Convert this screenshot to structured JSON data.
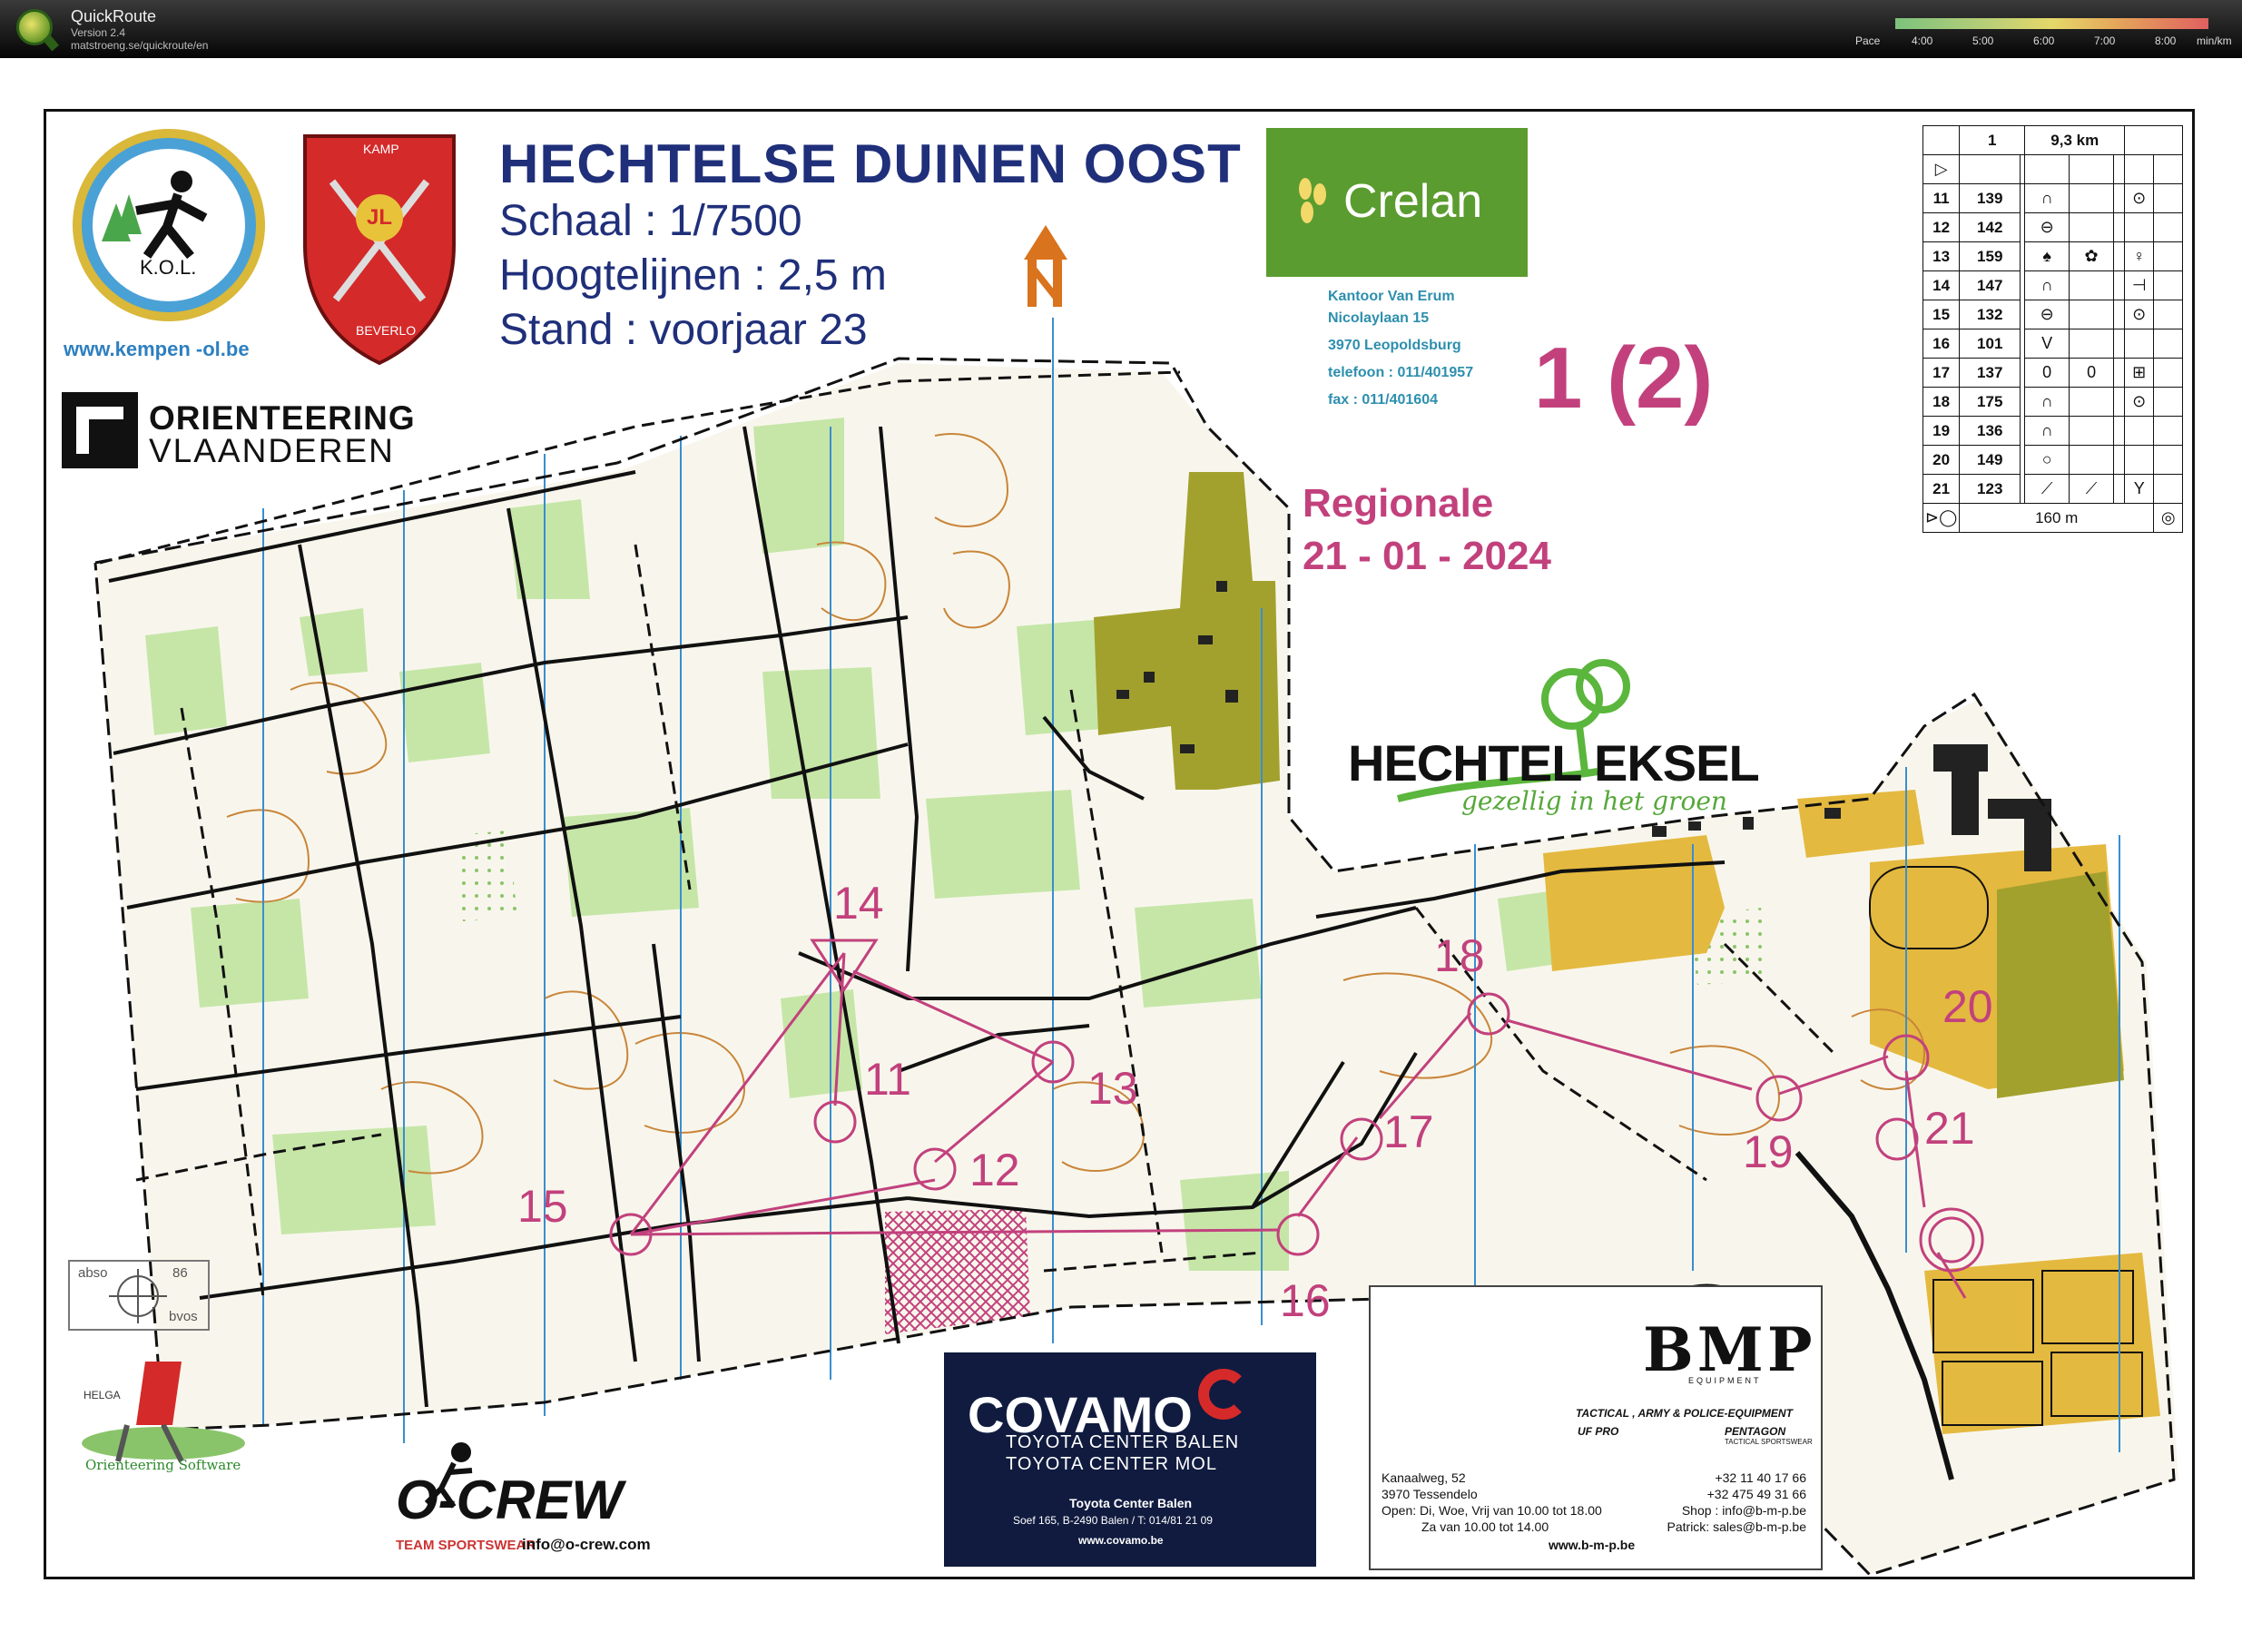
{
  "topbar": {
    "app_name": "QuickRoute",
    "version": "Version 2.4",
    "url": "matstroeng.se/quickroute/en",
    "pace_label": "Pace",
    "pace_ticks": [
      "4:00",
      "5:00",
      "6:00",
      "7:00",
      "8:00"
    ],
    "pace_unit": "min/km"
  },
  "map": {
    "title": "HECHTELSE DUINEN OOST",
    "scale": "Schaal : 1/7500",
    "contours": "Hoogtelijnen : 2,5 m",
    "status": "Stand : voorjaar 23",
    "club_name": "K.O.L.",
    "club_url": "www.kempen -ol.be",
    "kamp_top": "KAMP",
    "kamp_bottom": "BEVERLO",
    "kamp_letters": "JL",
    "orienteering_line1": "ORIENTEERING",
    "orienteering_line2": "VLAANDEREN",
    "course": "1 (2)",
    "event": "Regionale",
    "date": "21 - 01 - 2024"
  },
  "crelan": {
    "brand": "Crelan",
    "office": "Kantoor Van Erum",
    "street": "Nicolaylaan 15",
    "city": "3970 Leopoldsburg",
    "phone": "telefoon : 011/401957",
    "fax": "fax : 011/401604"
  },
  "hechtel": {
    "name": "HECHTEL EKSEL",
    "slogan": "gezellig in het groen"
  },
  "control_descriptions": {
    "course": "1",
    "length": "9,3 km",
    "rows": [
      {
        "num": "11",
        "code": "139",
        "feature": "∩",
        "detail": "",
        "pos": "⊙"
      },
      {
        "num": "12",
        "code": "142",
        "feature": "⊖",
        "detail": "",
        "pos": ""
      },
      {
        "num": "13",
        "code": "159",
        "feature": "♠",
        "detail": "✿",
        "pos": "♀"
      },
      {
        "num": "14",
        "code": "147",
        "feature": "∩",
        "detail": "",
        "pos": "⊣"
      },
      {
        "num": "15",
        "code": "132",
        "feature": "⊖",
        "detail": "",
        "pos": "⊙"
      },
      {
        "num": "16",
        "code": "101",
        "feature": "V",
        "detail": "",
        "pos": ""
      },
      {
        "num": "17",
        "code": "137",
        "feature": "0",
        "detail": "0",
        "pos": "⊞"
      },
      {
        "num": "18",
        "code": "175",
        "feature": "∩",
        "detail": "",
        "pos": "⊙"
      },
      {
        "num": "19",
        "code": "136",
        "feature": "∩",
        "detail": "",
        "pos": ""
      },
      {
        "num": "20",
        "code": "149",
        "feature": "○",
        "detail": "",
        "pos": ""
      },
      {
        "num": "21",
        "code": "123",
        "feature": "⟋",
        "detail": "⟋",
        "pos": "Y"
      }
    ],
    "finish_distance": "160 m"
  },
  "controls": [
    {
      "label": "14"
    },
    {
      "label": "11"
    },
    {
      "label": "13"
    },
    {
      "label": "12"
    },
    {
      "label": "15"
    },
    {
      "label": "16"
    },
    {
      "label": "17"
    },
    {
      "label": "18"
    },
    {
      "label": "19"
    },
    {
      "label": "20"
    },
    {
      "label": "21"
    }
  ],
  "compass": {
    "a": "abso",
    "b": "bvos",
    "n": "86"
  },
  "helga": {
    "name": "HELGA",
    "sub": "Orienteering Software"
  },
  "ocrew": {
    "brand": "O-CREW",
    "sub": "TEAM SPORTSWEAR",
    "mail": "info@o-crew.com"
  },
  "covamo": {
    "brand": "COVAMO",
    "line1": "TOYOTA CENTER BALEN",
    "line2": "TOYOTA CENTER MOL",
    "line3": "Toyota Center Balen",
    "line4": "Soef 165, B-2490 Balen / T: 014/81 21 09",
    "line5": "www.covamo.be"
  },
  "bmp": {
    "logo": "BMP",
    "equipment": "EQUIPMENT",
    "tagline": "TACTICAL , ARMY & POLICE-EQUIPMENT",
    "ufpro": "UF PRO",
    "pentagon": "PENTAGON",
    "pentagon_sub": "TACTICAL SPORTSWEAR",
    "addr1": "Kanaalweg, 52",
    "addr2": "3970 Tessendelo",
    "addr3": "Open: Di, Woe, Vrij van 10.00 tot 18.00",
    "addr4": "Za van 10.00 tot 14.00",
    "phone1": "+32 11 40 17 66",
    "phone2": "+32 475 49 31 66",
    "shop": "Shop : info@b-m-p.be",
    "patrick": "Patrick: sales@b-m-p.be",
    "web": "www.b-m-p.be"
  },
  "colors": {
    "course": "#c2417d",
    "title": "#1f2f7a",
    "forest_green": "#c6e6a8",
    "open_yellow": "#e7bd3e",
    "rough_open": "#f3e7b0",
    "olive": "#9c9a2a"
  }
}
